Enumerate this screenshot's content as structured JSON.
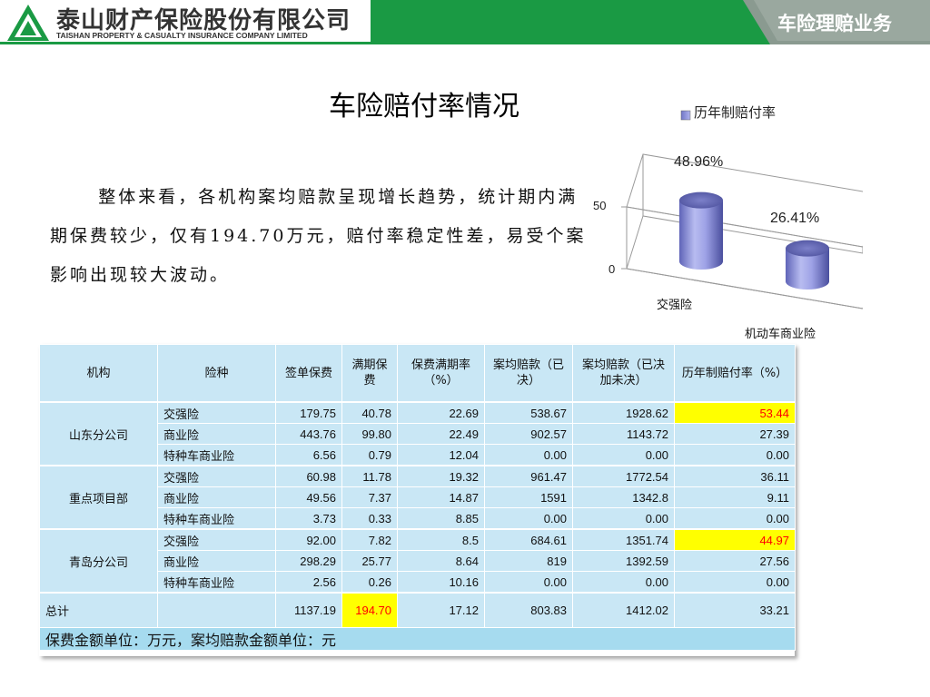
{
  "header": {
    "company_cn": "泰山财产保险股份有限公司",
    "company_en": "TAISHAN PROPERTY & CASUALTY INSURANCE COMPANY LIMITED",
    "section_tab": "车险理赔业务",
    "brand_green": "#1a9a44"
  },
  "page_title": "车险赔付率情况",
  "summary": {
    "line1": "整体来看，各机构案均赔款呈现增长趋势，统计期内满期保费较少，仅有194.70万元，赔付率稳定性差，易受个案影响出现较大波动。"
  },
  "chart_data": {
    "type": "bar",
    "style": "3d-cylinder",
    "legend": "历年制赔付率",
    "legend_placement": "top-right",
    "categories": [
      "交强险",
      "机动车商业险"
    ],
    "series": [
      {
        "name": "历年制赔付率",
        "values": [
          48.96,
          26.41
        ],
        "labels": [
          "48.96%",
          "26.41%"
        ]
      }
    ],
    "yticks": [
      "0",
      "50"
    ],
    "ylim": [
      0,
      60
    ],
    "grid": true,
    "color": "#8a8fd6"
  },
  "table": {
    "headers": [
      "机构",
      "险种",
      "签单保费",
      "满期保费",
      "保费满期率（%）",
      "案均赔款（已决）",
      "案均赔款（已决加未决）",
      "历年制赔付率（%）"
    ],
    "groups": [
      {
        "org": "山东分公司",
        "rows": [
          [
            "交强险",
            "179.75",
            "40.78",
            "22.69",
            "538.67",
            "1928.62",
            "53.44"
          ],
          [
            "商业险",
            "443.76",
            "99.80",
            "22.49",
            "902.57",
            "1143.72",
            "27.39"
          ],
          [
            "特种车商业险",
            "6.56",
            "0.79",
            "12.04",
            "0.00",
            "0.00",
            "0.00"
          ]
        ]
      },
      {
        "org": "重点项目部",
        "rows": [
          [
            "交强险",
            "60.98",
            "11.78",
            "19.32",
            "961.47",
            "1772.54",
            "36.11"
          ],
          [
            "商业险",
            "49.56",
            "7.37",
            "14.87",
            "1591",
            "1342.8",
            "9.11"
          ],
          [
            "特种车商业险",
            "3.73",
            "0.33",
            "8.85",
            "0.00",
            "0.00",
            "0.00"
          ]
        ]
      },
      {
        "org": "青岛分公司",
        "rows": [
          [
            "交强险",
            "92.00",
            "7.82",
            "8.5",
            "684.61",
            "1351.74",
            "44.97"
          ],
          [
            "商业险",
            "298.29",
            "25.77",
            "8.64",
            "819",
            "1392.59",
            "27.56"
          ],
          [
            "特种车商业险",
            "2.56",
            "0.26",
            "10.16",
            "0.00",
            "0.00",
            "0.00"
          ]
        ]
      }
    ],
    "total": [
      "总计",
      "",
      "1137.19",
      "194.70",
      "17.12",
      "803.83",
      "1412.02",
      "33.21"
    ],
    "footnote": "保费金额单位：万元，案均赔款金额单位：元",
    "highlight_bg": "#ffff00",
    "highlight_text": "#ff0000"
  }
}
